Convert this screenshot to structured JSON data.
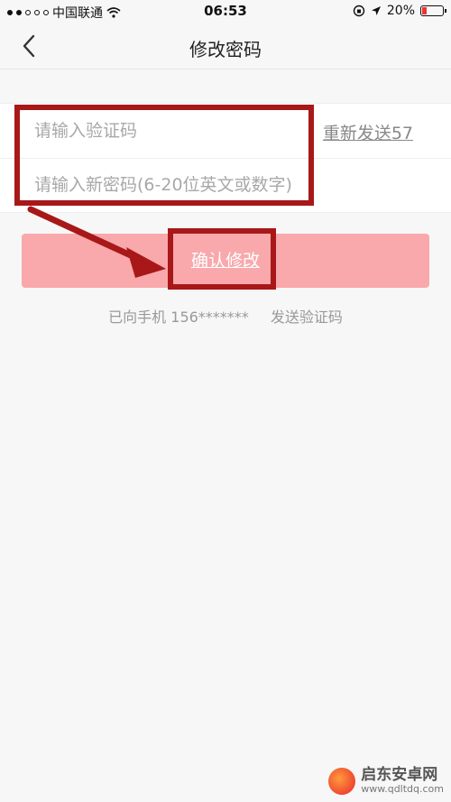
{
  "status_bar": {
    "carrier": "中国联通",
    "time": "06:53",
    "battery": "20%"
  },
  "nav": {
    "title": "修改密码"
  },
  "form": {
    "code_placeholder": "请输入验证码",
    "resend_label": "重新发送57",
    "password_placeholder": "请输入新密码(6-20位英文或数字)"
  },
  "confirm_label": "确认修改",
  "hint": {
    "prefix": "已向手机 156*******",
    "suffix": "发送验证码"
  },
  "watermark": {
    "title": "启东安卓网",
    "url": "www.qdltdq.com"
  },
  "colors": {
    "button": "#f9a8ac",
    "annotation": "#a81818"
  }
}
